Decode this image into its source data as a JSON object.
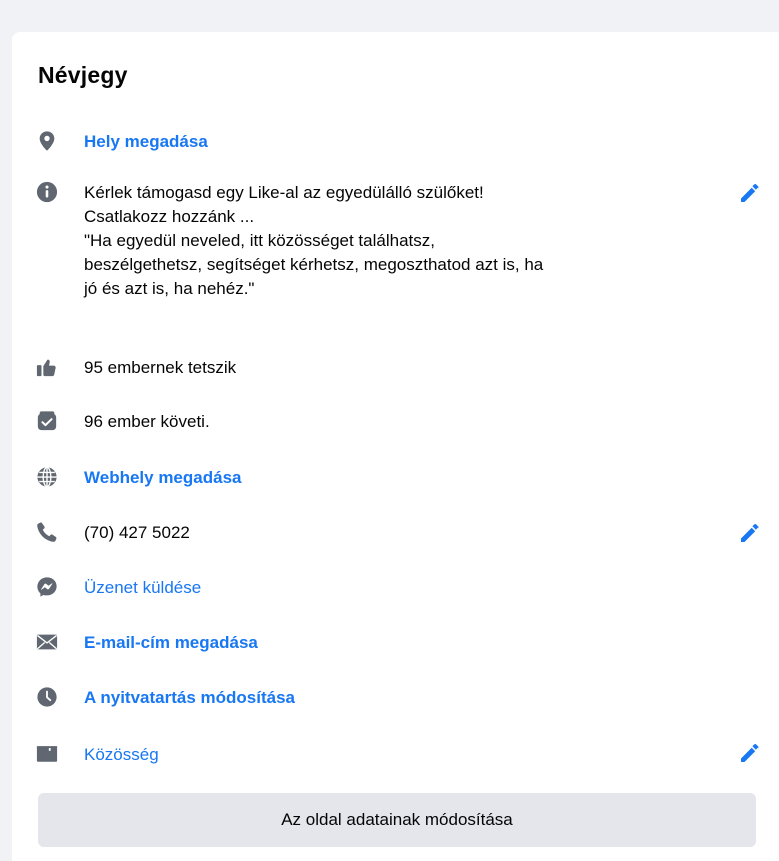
{
  "card": {
    "title": "Névjegy",
    "location_link": "Hely megadása",
    "description_lines": [
      "Kérlek támogasd egy Like-al az egyedülálló szülőket!",
      "Csatlakozz hozzánk ...",
      "\"Ha egyedül neveled, itt közösséget találhatsz,",
      "beszélgethetsz, segítséget kérhetsz, megoszthatod azt is, ha",
      "jó és azt is, ha nehéz.\""
    ],
    "likes_text": "95 embernek tetszik",
    "followers_text": "96 ember követi.",
    "website_link": "Webhely megadása",
    "phone": "(70) 427 5022",
    "message_link": "Üzenet küldése",
    "email_link": "E-mail-cím megadása",
    "hours_link": "A nyitvatartás módosítása",
    "category_link": "Közösség",
    "edit_page_button": "Az oldal adatainak módosítása"
  },
  "colors": {
    "link": "#1877f2",
    "icon": "#606770",
    "text": "#050505",
    "button_bg": "#e4e6eb",
    "page_bg": "#f0f2f5"
  },
  "icons": [
    "map-pin-icon",
    "info-icon",
    "thumbs-up-icon",
    "follow-check-icon",
    "globe-icon",
    "phone-icon",
    "messenger-icon",
    "envelope-icon",
    "clock-icon",
    "category-tag-icon",
    "pencil-icon"
  ]
}
